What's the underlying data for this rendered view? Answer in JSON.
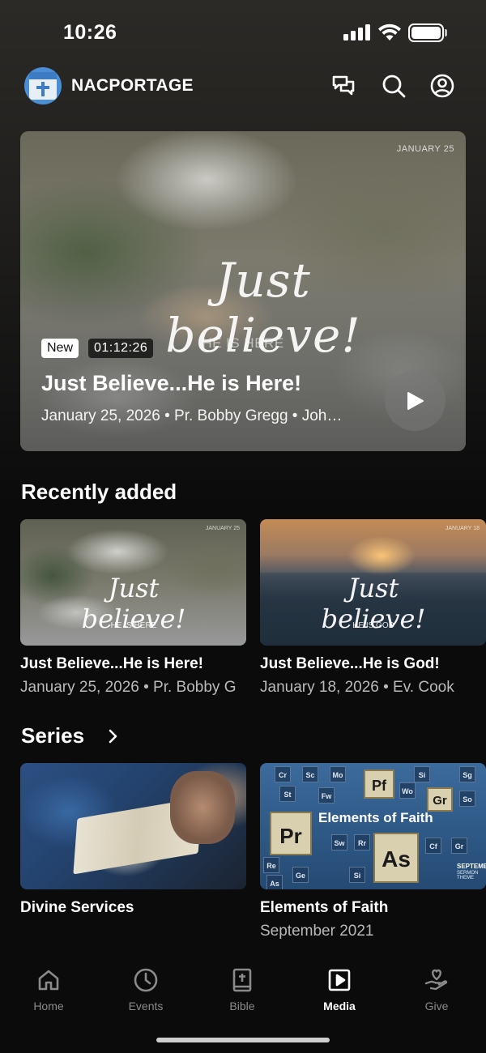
{
  "status_bar": {
    "time": "10:26"
  },
  "header": {
    "app_name": "NACPORTAGE"
  },
  "hero": {
    "date_mark": "JANUARY 25",
    "script_title": "Just believe!",
    "script_subtitle": "HE IS HERE",
    "badge_new": "New",
    "duration": "01:12:26",
    "title": "Just Believe...He is Here!",
    "meta": "January 25, 2026 • Pr. Bobby Gregg • Joh…"
  },
  "recently_added": {
    "title": "Recently added",
    "items": [
      {
        "date_mark": "JANUARY 25",
        "script": "Just believe!",
        "sub": "HE IS HERE",
        "title": "Just Believe...He is Here!",
        "meta": "January 25, 2026 • Pr. Bobby G"
      },
      {
        "date_mark": "JANUARY 18",
        "script": "Just believe!",
        "sub": "HE IS GOD",
        "title": "Just Believe...He is God!",
        "meta": "January 18, 2026 • Ev. Cook"
      }
    ]
  },
  "series": {
    "title": "Series",
    "items": [
      {
        "title": "Divine Services",
        "meta": ""
      },
      {
        "title": "Elements of Faith",
        "meta": "September 2021",
        "thumb_title": "Elements of Faith",
        "thumb_month": "SEPTEMBER",
        "thumb_theme": "SERMON THEME"
      }
    ]
  },
  "tabs": [
    {
      "label": "Home",
      "icon": "home-icon",
      "active": false
    },
    {
      "label": "Events",
      "icon": "clock-icon",
      "active": false
    },
    {
      "label": "Bible",
      "icon": "bible-icon",
      "active": false
    },
    {
      "label": "Media",
      "icon": "media-play-icon",
      "active": true
    },
    {
      "label": "Give",
      "icon": "give-heart-hand-icon",
      "active": false
    }
  ],
  "colors": {
    "background": "#0b0b0b",
    "active_tab": "#ffffff",
    "inactive_tab": "#8a8a8a"
  }
}
